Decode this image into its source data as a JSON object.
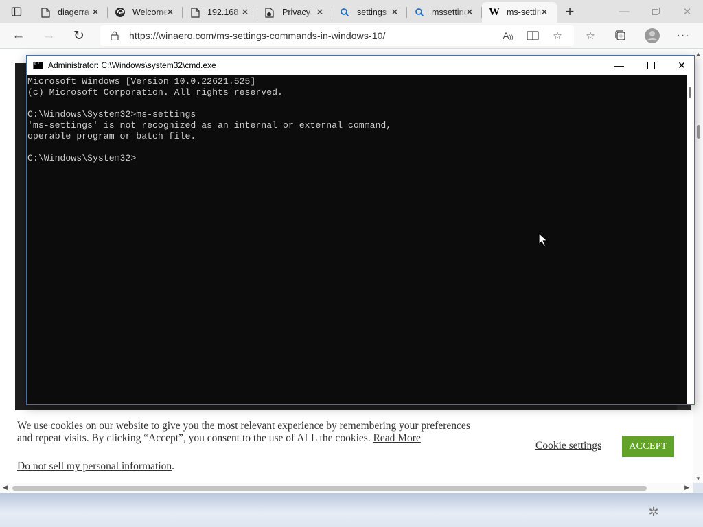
{
  "browser": {
    "tabs": [
      {
        "title": "diagerra",
        "icon": "page-icon"
      },
      {
        "title": "Welcome",
        "icon": "edge-icon"
      },
      {
        "title": "192.168",
        "icon": "page-icon"
      },
      {
        "title": "Privacy",
        "icon": "privacy-page-icon"
      },
      {
        "title": "settings",
        "icon": "search-icon"
      },
      {
        "title": "mssettings",
        "icon": "search-icon"
      },
      {
        "title": "ms-settings",
        "icon": "winaero-w-icon"
      }
    ],
    "active_tab_index": 6,
    "url": "https://winaero.com/ms-settings-commands-in-windows-10/"
  },
  "cmd": {
    "title": "Administrator: C:\\Windows\\system32\\cmd.exe",
    "lines": [
      "Microsoft Windows [Version 10.0.22621.525]",
      "(c) Microsoft Corporation. All rights reserved.",
      "",
      "C:\\Windows\\System32>ms-settings",
      "'ms-settings' is not recognized as an internal or external command,",
      "operable program or batch file.",
      "",
      "C:\\Windows\\System32>"
    ]
  },
  "cookie": {
    "text": "We use cookies on our website to give you the most relevant experience by remembering your preferences and repeat visits. By clicking “Accept”, you consent to the use of ALL the cookies.",
    "read_more": "Read More",
    "do_not_sell": "Do not sell my personal information",
    "do_not_sell_suffix": ".",
    "settings_label": "Cookie settings",
    "accept_label": "ACCEPT",
    "accept_color": "#61a229"
  }
}
